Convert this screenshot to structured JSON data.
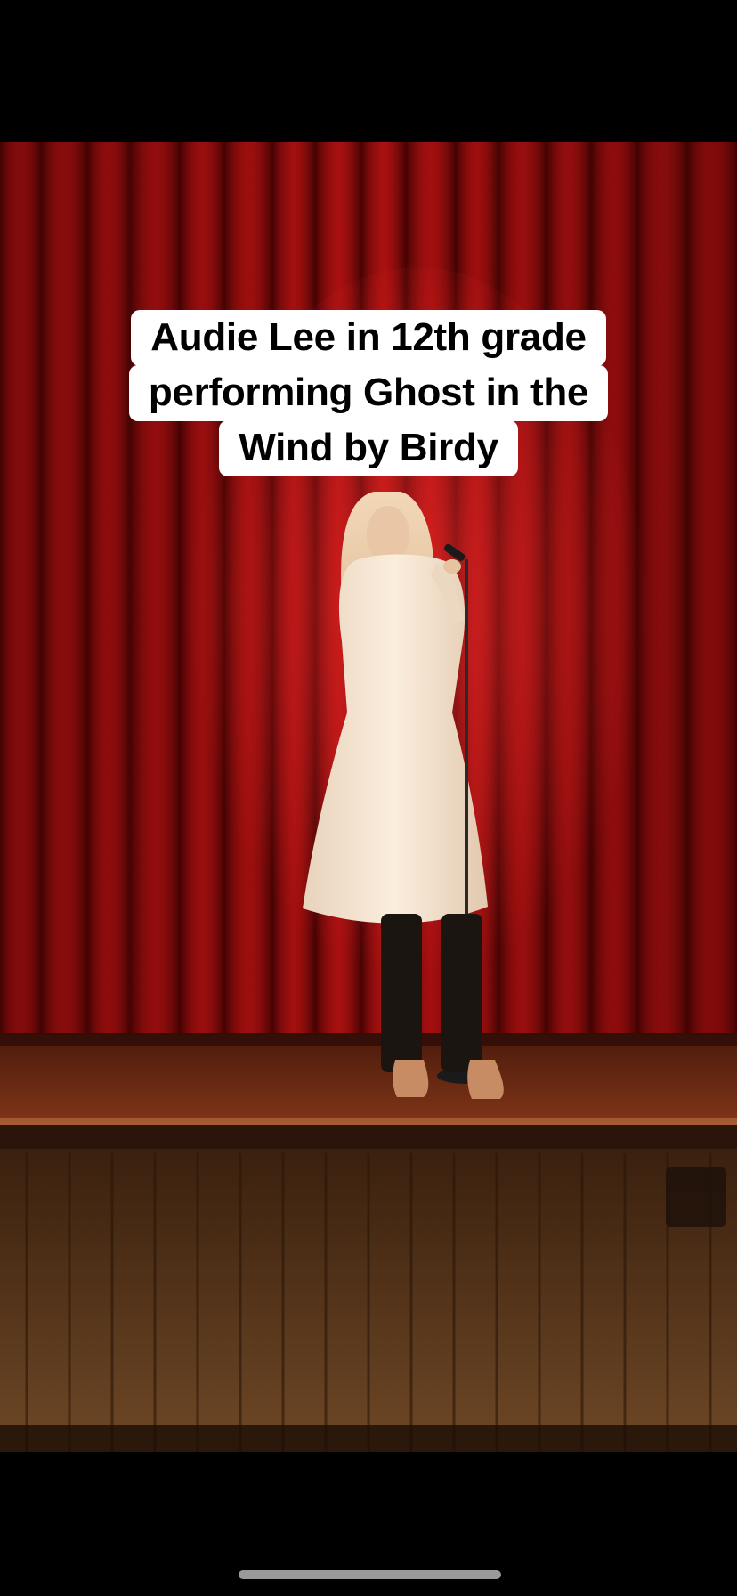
{
  "video": {
    "caption_lines": [
      "Audie Lee in 12th grade",
      "performing Ghost in the",
      "Wind by Birdy"
    ]
  },
  "colors": {
    "background": "#000000",
    "curtain": "#8f0a0a",
    "stage_floor": "#6b2a14",
    "stage_front": "#5a3418",
    "caption_bg": "#ffffff",
    "caption_text": "#000000",
    "home_indicator": "#9a9a9a"
  }
}
